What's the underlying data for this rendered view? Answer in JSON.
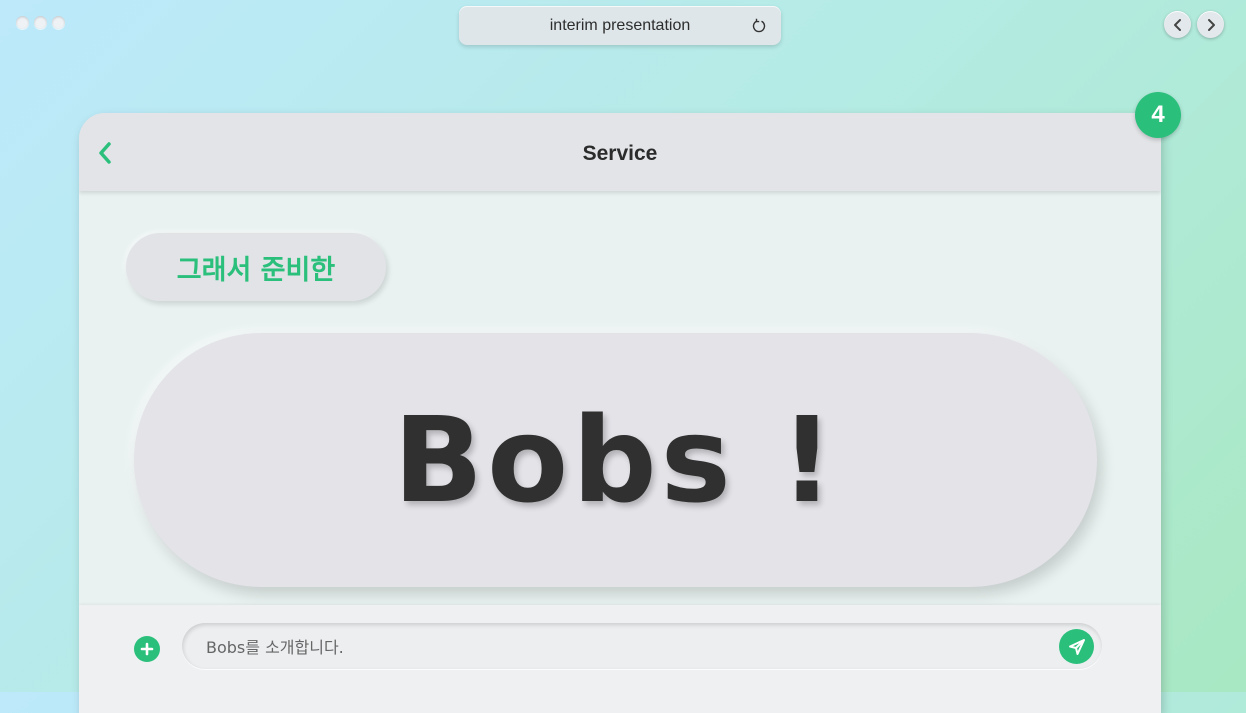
{
  "browser": {
    "url_title": "interim presentation",
    "reload_icon": "reload-icon",
    "back_icon": "chevron-left-icon",
    "forward_icon": "chevron-right-icon"
  },
  "slide": {
    "number": "4"
  },
  "app": {
    "header_title": "Service",
    "back_icon": "chevron-left-icon"
  },
  "messages": {
    "small_bubble": "그래서 준비한",
    "big_bubble": "Bobs !"
  },
  "composer": {
    "input_value": "Bobs를 소개합니다.",
    "plus_icon": "plus-icon",
    "send_icon": "send-icon"
  },
  "colors": {
    "accent": "#2bbf7c",
    "text_dark": "#303030"
  }
}
